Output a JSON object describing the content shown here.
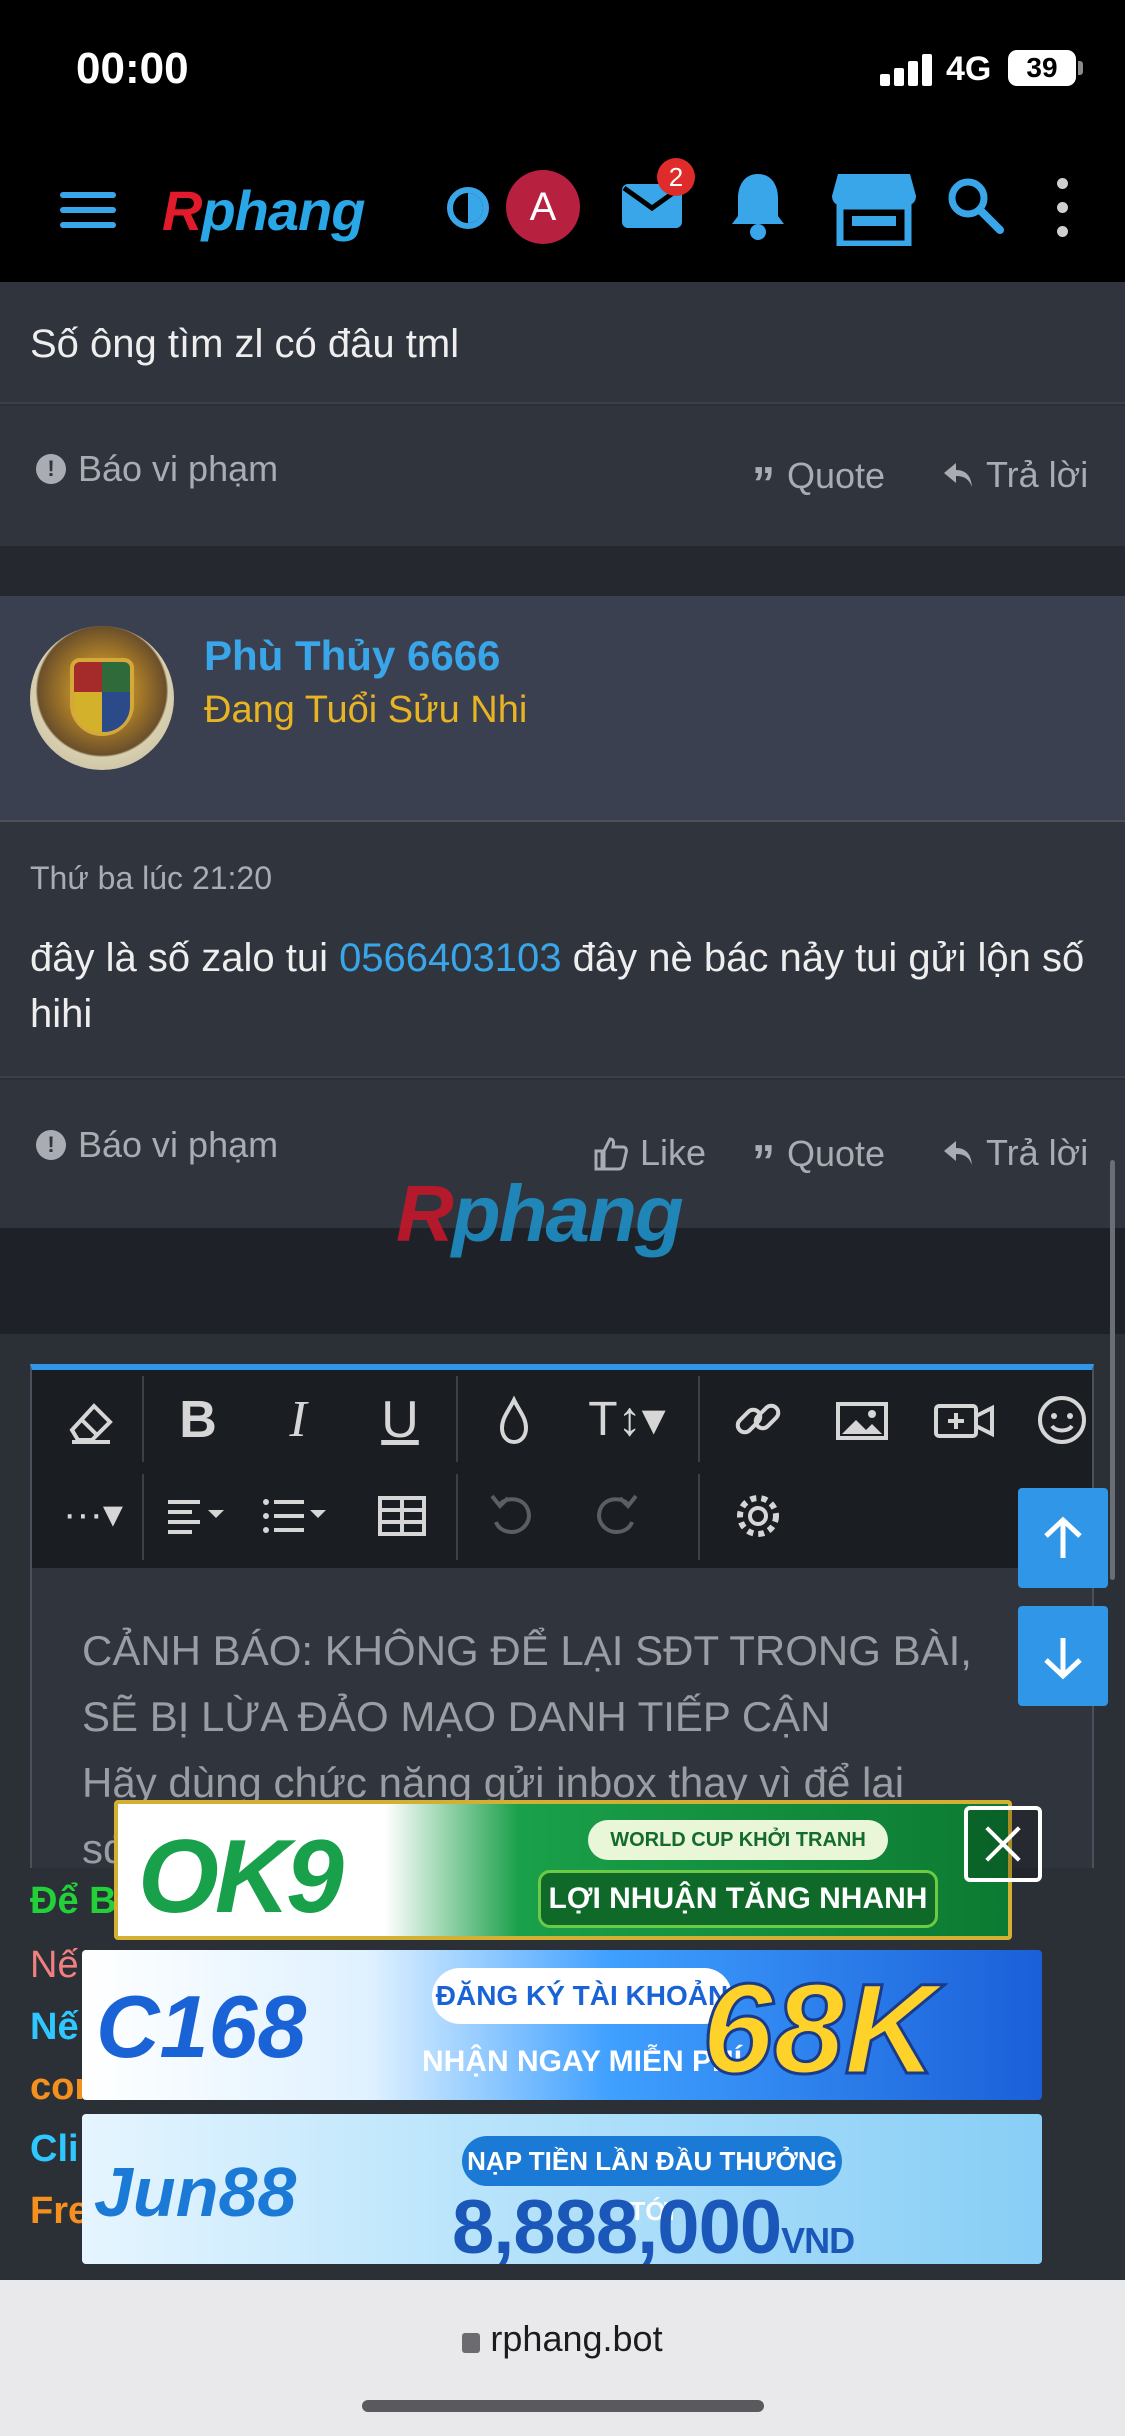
{
  "status_bar": {
    "time": "00:00",
    "network": "4G",
    "battery": "39"
  },
  "header": {
    "logo_part1": "R",
    "logo_part2": "phang",
    "avatar_letter": "A",
    "mail_badge": "2"
  },
  "post1": {
    "text": "Số ông tìm zl có đâu tml",
    "report_label": "Báo vi phạm",
    "quote_label": "Quote",
    "reply_label": "Trả lời"
  },
  "post2": {
    "username": "Phù Thủy 6666",
    "user_title": "Đang Tuổi Sửu Nhi",
    "timestamp": "Thứ ba lúc 21:20",
    "text_before": "đây là số zalo tui ",
    "phone": "0566403103",
    "text_after": " đây nè bác nảy tui gửi lộn số hihi",
    "report_label": "Báo vi phạm",
    "like_label": "Like",
    "quote_label": "Quote",
    "reply_label": "Trả lời"
  },
  "watermark": {
    "part1": "R",
    "part2": "phang"
  },
  "editor": {
    "placeholder_line1": "CẢNH BÁO: KHÔNG ĐỂ LẠI SĐT TRONG BÀI,",
    "placeholder_line2": "SẼ BỊ LỪA ĐẢO MẠO DANH TIẾP CẬN",
    "placeholder_line3": "Hãy dùng chức năng gửi inbox thay vì để lại",
    "placeholder_line4": "sđ"
  },
  "signature_fragments": {
    "line1": "Để B",
    "line2": "Nế",
    "line3": "Nế",
    "line4": "converter.com",
    "line5": "Cli",
    "line6": "Fre"
  },
  "ads": {
    "ok9": {
      "logo": "OK9",
      "tag1": "WORLD CUP KHỞI TRANH",
      "tag2": "LỢI NHUẬN TĂNG NHANH"
    },
    "c168": {
      "logo": "C168",
      "tag1": "ĐĂNG KÝ TÀI KHOẢN",
      "tag2": "NHẬN NGAY MIỄN PHÍ",
      "amount": "68K"
    },
    "jun88": {
      "logo": "Jun88",
      "tag1": "NẠP TIỀN LẦN ĐẦU THƯỞNG TỚI",
      "amount": "8,888,000",
      "unit": "VND"
    }
  },
  "browser": {
    "url": "rphang.bot"
  },
  "colors": {
    "accent": "#3aa6ea",
    "link": "#3aa6ea",
    "title_gold": "#e8b422",
    "editor_border": "#2f96e8"
  }
}
